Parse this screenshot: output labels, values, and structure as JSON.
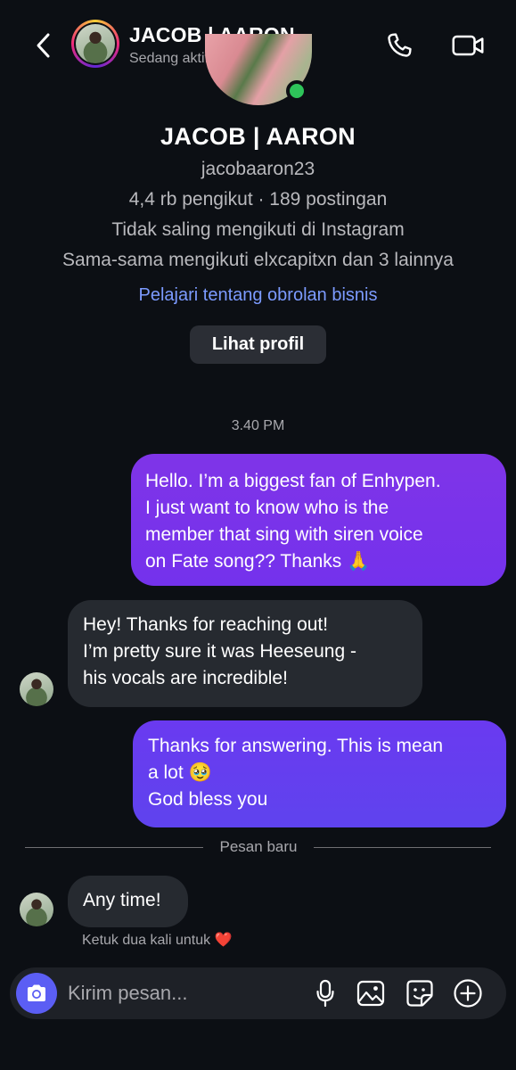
{
  "header": {
    "name": "JACOB | AARON",
    "status": "Sedang aktif",
    "back_icon": "chevron-left-icon",
    "call_icon": "phone-icon",
    "video_icon": "video-camera-icon"
  },
  "profile": {
    "name": "JACOB | AARON",
    "username": "jacobaaron23",
    "stats": "4,4 rb pengikut · 189 postingan",
    "follow_status": "Tidak saling mengikuti di Instagram",
    "mutual": "Sama-sama mengikuti elxcapitxn dan 3 lainnya",
    "learn_link": "Pelajari tentang obrolan bisnis",
    "view_profile_label": "Lihat profil"
  },
  "timestamp": "3.40 PM",
  "messages": [
    {
      "direction": "outgoing",
      "lines": [
        "Hello. I’m a biggest fan of Enhypen.",
        "I just want to know who is the",
        "member that sing with siren voice",
        "on Fate song?? Thanks 🙏"
      ]
    },
    {
      "direction": "incoming",
      "lines": [
        "Hey! Thanks for reaching out!",
        "I’m pretty sure it was Heeseung -",
        "his vocals are incredible!"
      ]
    },
    {
      "direction": "outgoing",
      "lines": [
        "Thanks for answering. This is mean",
        "a lot 🥹",
        "God bless you"
      ]
    },
    {
      "direction": "incoming",
      "lines": [
        "Any time!"
      ]
    }
  ],
  "new_messages_divider": "Pesan baru",
  "double_tap_hint": "Ketuk dua kali untuk ❤️",
  "composer": {
    "placeholder": "Kirim pesan...",
    "camera_icon": "camera-icon",
    "mic_icon": "microphone-icon",
    "gallery_icon": "image-gallery-icon",
    "sticker_icon": "sticker-icon",
    "add_icon": "plus-circle-icon"
  },
  "colors": {
    "background": "#0c0f14",
    "outgoing_bubble": "#7432ec",
    "incoming_bubble": "#262a30",
    "link": "#7c9bff",
    "online": "#2ec45a"
  }
}
